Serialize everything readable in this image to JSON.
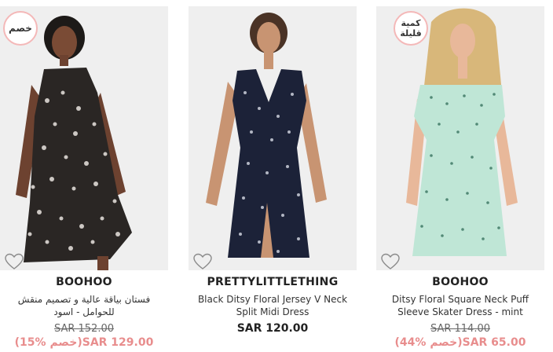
{
  "products": [
    {
      "badge": "خصم",
      "brand": "BOOHOO",
      "name": "فستان بياقة عالية و تصميم منقش للحوامل - اسود",
      "old_price": "SAR 152.00",
      "sale_price": "SAR 129.00",
      "discount": "(15% خصم)",
      "wishlist_icon": "heart-outline-icon"
    },
    {
      "brand": "PRETTYLITTLETHING",
      "name": "Black Ditsy Floral Jersey V Neck Split Midi Dress",
      "price": "SAR 120.00",
      "wishlist_icon": "heart-outline-icon"
    },
    {
      "badge": "كمية قليلة",
      "brand": "BOOHOO",
      "name": "Ditsy Floral Square Neck Puff Sleeve Skater Dress - mint",
      "old_price": "SAR 114.00",
      "sale_price": "SAR 65.00",
      "discount": "(44% خصم)",
      "wishlist_icon": "heart-outline-icon"
    }
  ],
  "colors": {
    "sale_price": "#e88d8d",
    "badge_border": "#f4b8b8",
    "photo_bg": "#efefef"
  }
}
